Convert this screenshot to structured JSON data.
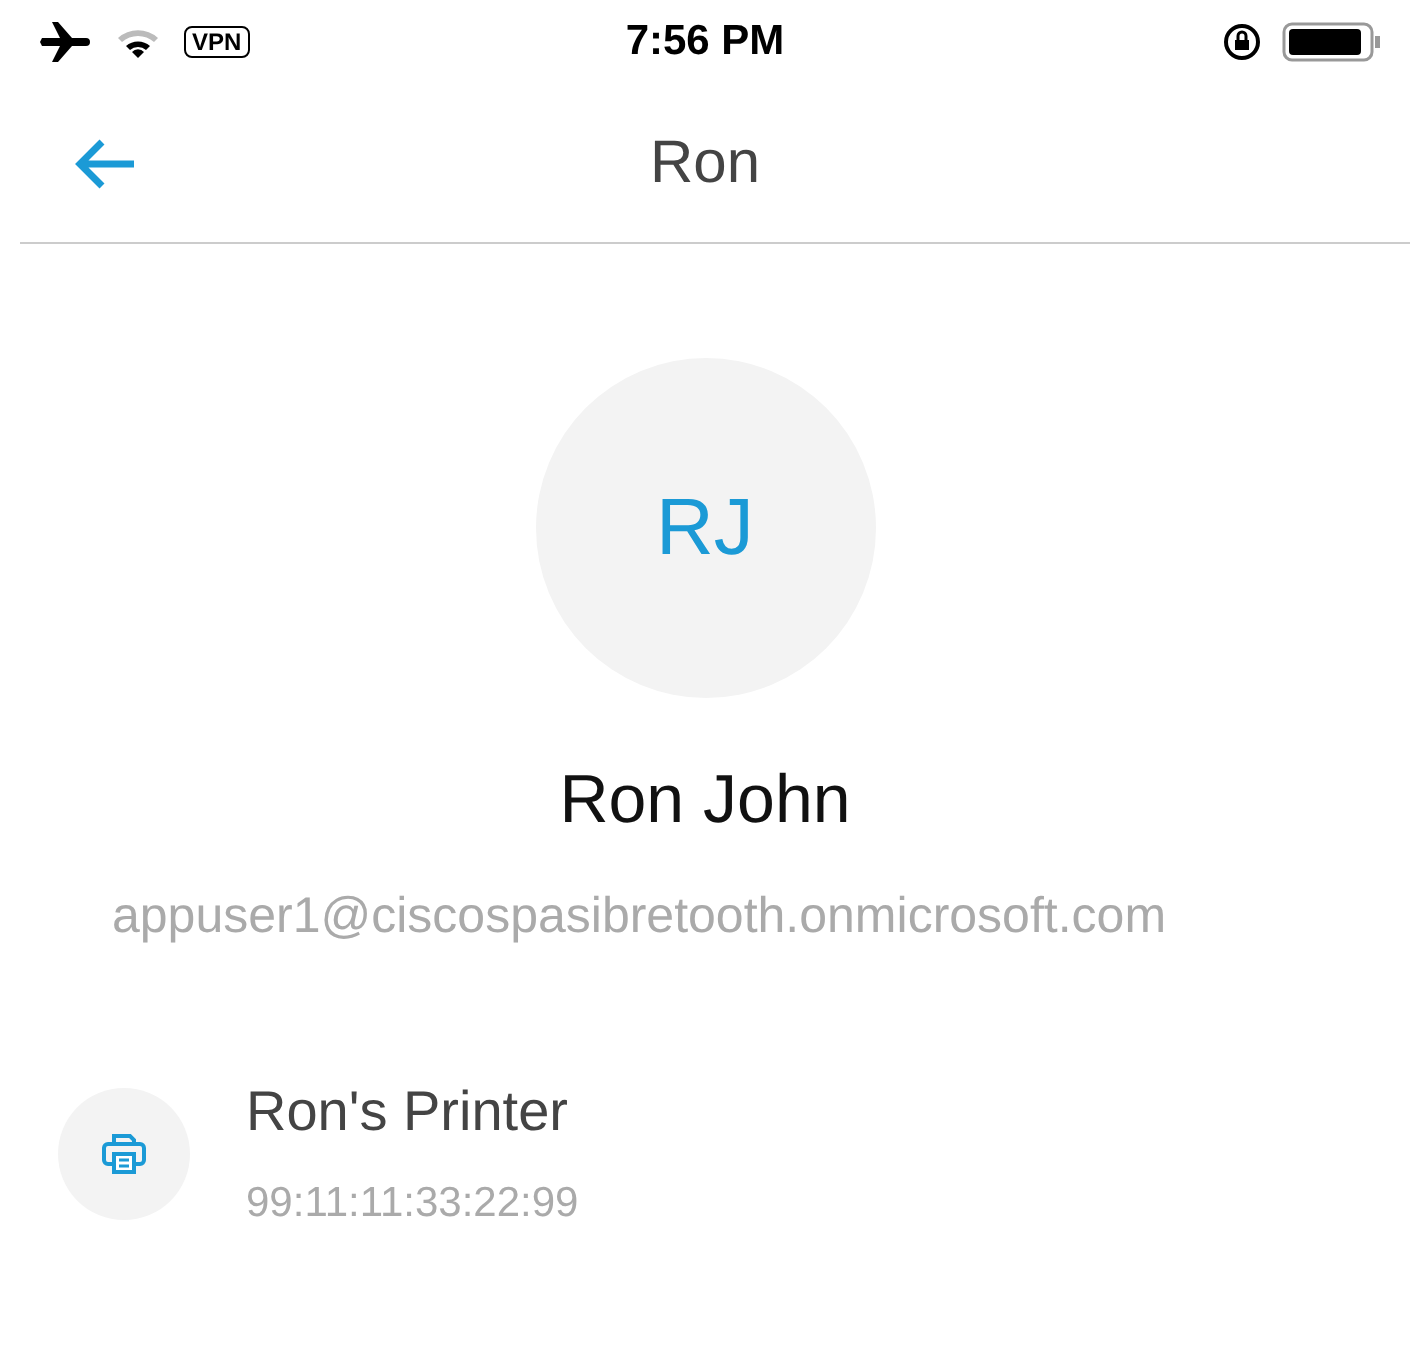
{
  "status_bar": {
    "vpn": "VPN",
    "time": "7:56 PM"
  },
  "nav": {
    "title": "Ron"
  },
  "contact": {
    "initials": "RJ",
    "name": "Ron John",
    "email": "appuser1@ciscospasibretooth.onmicrosoft.com"
  },
  "devices": [
    {
      "kind": "printer",
      "name": "Ron's Printer",
      "address": "99:11:11:33:22:99"
    }
  ]
}
